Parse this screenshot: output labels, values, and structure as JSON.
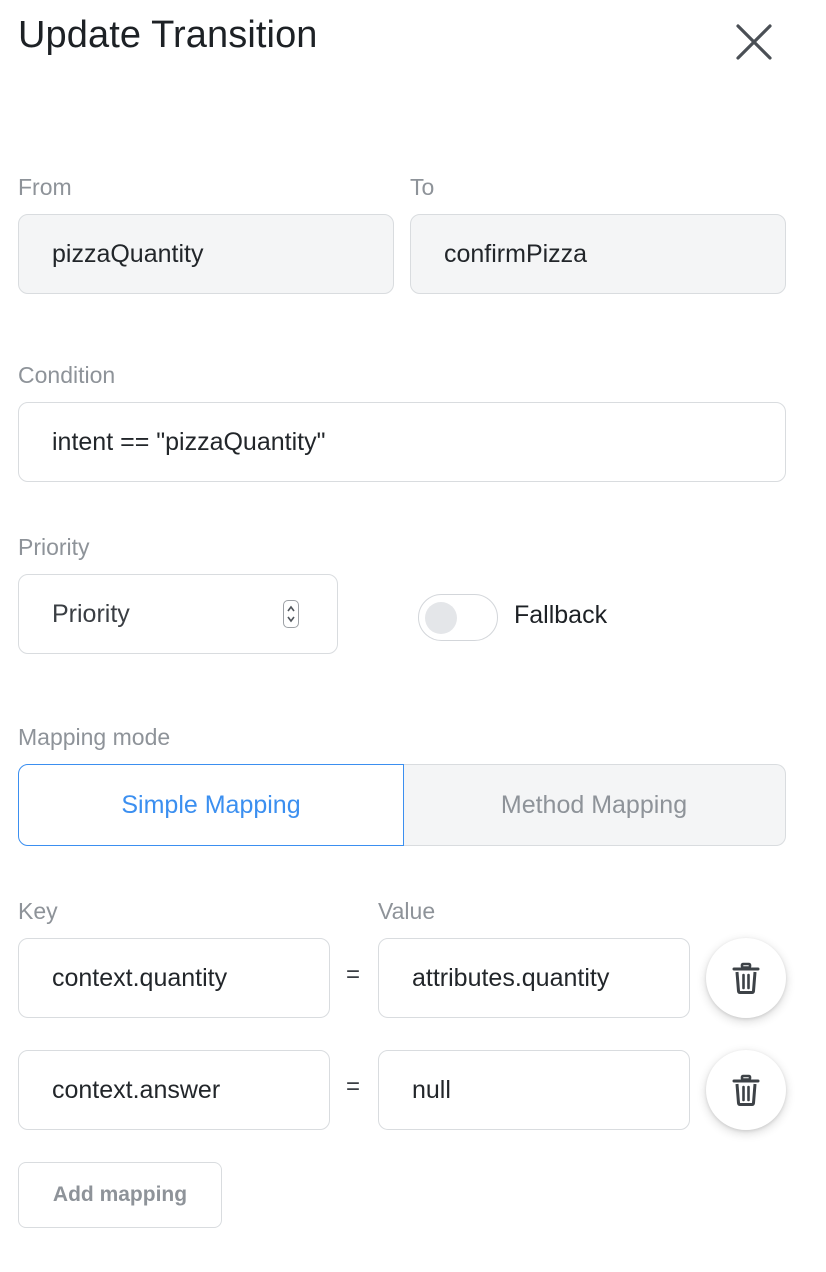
{
  "header": {
    "title": "Update Transition",
    "close_icon": "close-icon"
  },
  "from": {
    "label": "From",
    "value": "pizzaQuantity"
  },
  "to": {
    "label": "To",
    "value": "confirmPizza"
  },
  "condition": {
    "label": "Condition",
    "value": "intent == \"pizzaQuantity\""
  },
  "priority": {
    "label": "Priority",
    "placeholder": "Priority"
  },
  "fallback": {
    "label": "Fallback",
    "enabled": false
  },
  "mapping_mode": {
    "label": "Mapping mode",
    "options": [
      "Simple Mapping",
      "Method Mapping"
    ],
    "selected": "Simple Mapping",
    "active_color": "#3b8ff0"
  },
  "mappings": {
    "key_label": "Key",
    "value_label": "Value",
    "equals": "=",
    "rows": [
      {
        "key": "context.quantity",
        "value": "attributes.quantity"
      },
      {
        "key": "context.answer",
        "value": "null"
      }
    ],
    "delete_icon": "trash-icon",
    "add_label": "Add mapping"
  }
}
